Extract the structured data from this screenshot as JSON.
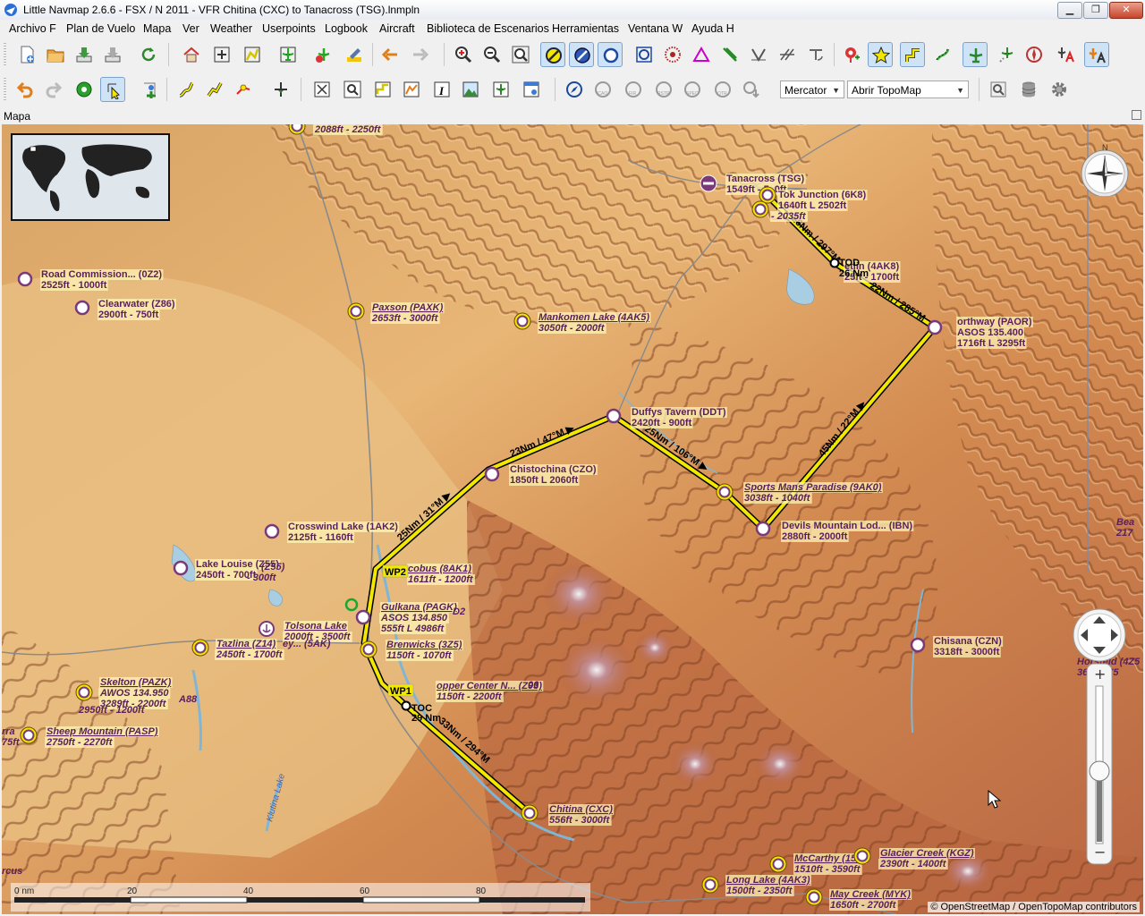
{
  "window": {
    "title": "Little Navmap 2.6.6 - FSX / N 2011 - VFR Chitina (CXC) to Tanacross (TSG).lnmpln",
    "min_label": "▁",
    "max_label": "❐",
    "close_label": "✕"
  },
  "menu": [
    {
      "label": "Archivo F",
      "key": "archivo"
    },
    {
      "label": "Plan de Vuelo",
      "key": "plan"
    },
    {
      "label": "Mapa",
      "key": "mapa"
    },
    {
      "label": "Ver",
      "key": "ver"
    },
    {
      "label": "Weather",
      "key": "weather"
    },
    {
      "label": "Userpoints",
      "key": "userpoints"
    },
    {
      "label": "Logbook",
      "key": "logbook"
    },
    {
      "label": "Aircraft",
      "key": "aircraft"
    },
    {
      "label": "Biblioteca de Escenarios",
      "key": "biblioteca"
    },
    {
      "label": "Herramientas",
      "key": "herramientas"
    },
    {
      "label": "Ventana W",
      "key": "ventana"
    },
    {
      "label": "Ayuda H",
      "key": "ayuda"
    }
  ],
  "toolbar": {
    "projection": "Mercator",
    "theme": "Abrir TopoMap"
  },
  "dock": {
    "title": "Mapa"
  },
  "colors": {
    "route": "#f2e700",
    "route_outline": "#000000",
    "airport_ring": "#f2e700",
    "airport_purple": "#7a3a7a",
    "label_purple": "#5a1f5a"
  },
  "map": {
    "compass_label": "N",
    "airports": [
      {
        "name": "Tanacross (TSG)",
        "info": "1549ft - 5_0ft",
        "italic": false
      },
      {
        "name": "Tok Junction (6K8)",
        "info": "1640ft L 2502ft",
        "italic": false
      },
      {
        "name": "",
        "info": "- 2035ft",
        "italic": true
      },
      {
        "name": "etlin (4AK8)",
        "info": "25ft - 1700ft",
        "italic": false
      },
      {
        "name": "orthway (PAOR)",
        "info": "ASOS 135.400",
        "info2": "1716ft L 3295ft",
        "italic": false
      },
      {
        "name": "Road Commission... (0Z2)",
        "info": "2525ft - 1000ft",
        "italic": false
      },
      {
        "name": "Clearwater (Z86)",
        "info": "2900ft - 750ft",
        "italic": false
      },
      {
        "name": "Paxson (PAXK)",
        "info": "2653ft - 3000ft",
        "italic": true
      },
      {
        "name": "Mankomen Lake (4AK5)",
        "info": "3050ft - 2000ft",
        "italic": true
      },
      {
        "name": "Duffys Tavern (DDT)",
        "info": "2420ft - 900ft",
        "italic": false
      },
      {
        "name": "Chistochina (CZO)",
        "info": "1850ft L 2060ft",
        "italic": false
      },
      {
        "name": "Sports Mans Paradise (9AK0)",
        "info": "3038ft - 1040ft",
        "italic": true
      },
      {
        "name": "Devils Mountain Lod... (IBN)",
        "info": "2880ft - 2000ft",
        "italic": false
      },
      {
        "name": "Crosswind Lake (1AK2)",
        "info": "2125ft - 1160ft",
        "italic": false
      },
      {
        "name": "Lake Louise (Z55)",
        "info": "2450ft - 700ft",
        "italic": false
      },
      {
        "name": "cobus (8AK1)",
        "info": "1611ft - 1200ft",
        "italic": true
      },
      {
        "name": "Gulkana (PAGK)",
        "info": "ASOS 134.850",
        "info2": "555ft L 4986ft",
        "italic": true
      },
      {
        "name": "Tolsona Lake",
        "info": "2000ft - 3500ft",
        "italic": true
      },
      {
        "name": "Tazlina (Z14)",
        "info": "2450ft - 1700ft",
        "italic": true
      },
      {
        "name": "Brenwicks (3Z5)",
        "info": "1150ft - 1070ft",
        "italic": true
      },
      {
        "name": "Skelton (PAZK)",
        "info": "AWOS 134.950",
        "info2": "3289ft - 2200ft",
        "italic": true
      },
      {
        "name": "Sheep Mountain (PASP)",
        "info": "2750ft - 2270ft",
        "italic": true
      },
      {
        "name": "opper Center N... (Z93)",
        "info": "1150ft - 2200ft",
        "italic": true
      },
      {
        "name": "Chisana (CZN)",
        "info": "3318ft - 3000ft",
        "italic": false
      },
      {
        "name": "Chitina (CXC)",
        "info": "556ft - 3000ft",
        "italic": true
      },
      {
        "name": "McCarthy (15Z)",
        "info": "1510ft - 3590ft",
        "italic": true
      },
      {
        "name": "Glacier Creek (KGZ)",
        "info": "2390ft - 1400ft",
        "italic": true
      },
      {
        "name": "Long Lake (4AK3)",
        "info": "1500ft - 2350ft",
        "italic": true
      },
      {
        "name": "May Creek (MYK)",
        "info": "1650ft - 2700ft",
        "italic": true
      },
      {
        "name": "",
        "info": "2088ft - 2250ft",
        "italic": true
      }
    ],
    "legs": [
      {
        "label": "33Nm / 294°M"
      },
      {
        "label": "25Nm / 31°M ▶"
      },
      {
        "label": "23Nm / 47°M ▶"
      },
      {
        "label": "25Nm / 106°M ▶"
      },
      {
        "label": "45Nm / 22°M ▶"
      },
      {
        "label": "22Nm / 285°M"
      },
      {
        "label": "26Nm / 297°M"
      }
    ],
    "markers": [
      {
        "label": "TOC",
        "sub": "29 Nm"
      },
      {
        "label": "TOD",
        "sub": "26 Nm"
      },
      {
        "label": "WP1"
      },
      {
        "label": "WP2"
      }
    ],
    "partial_labels": [
      "Bea",
      "217",
      "Horsfeld (4Z5",
      "36 - 1075",
      "ey... (5AK)",
      "A88",
      "2950ft - 1200ft",
      "rra",
      "75ft",
      "(Z55)",
      "- 300ft",
      "D2",
      "06",
      "rcus"
    ],
    "places": [
      "Klutina Lake"
    ],
    "scale": {
      "ticks": [
        "0 nm",
        "20",
        "40",
        "60",
        "80"
      ]
    },
    "attribution": "© OpenStreetMap / OpenTopoMap contributors"
  }
}
